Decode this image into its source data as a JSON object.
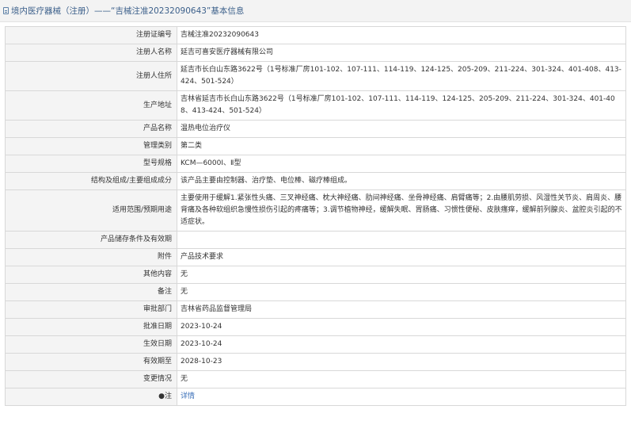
{
  "header": {
    "title": "境内医疗器械（注册）——“吉械注准20232090643”基本信息"
  },
  "rows": [
    {
      "label": "注册证编号",
      "value": "吉械注准20232090643"
    },
    {
      "label": "注册人名称",
      "value": "延吉可喜安医疗器械有限公司"
    },
    {
      "label": "注册人住所",
      "value": "延吉市长白山东路3622号（1号标准厂房101-102、107-111、114-119、124-125、205-209、211-224、301-324、401-408、413-424、501-524）"
    },
    {
      "label": "生产地址",
      "value": "吉林省延吉市长白山东路3622号（1号标准厂房101-102、107-111、114-119、124-125、205-209、211-224、301-324、401-408、413-424、501-524）"
    },
    {
      "label": "产品名称",
      "value": "温热电位治疗仪"
    },
    {
      "label": "管理类别",
      "value": "第二类"
    },
    {
      "label": "型号规格",
      "value": "KCM—6000Ⅰ、Ⅱ型"
    },
    {
      "label": "结构及组成/主要组成成分",
      "value": "该产品主要由控制器、治疗垫、电位棒、磁疗棒组成。"
    },
    {
      "label": "适用范围/预期用途",
      "value": "主要使用于缓解1.紧张性头痛、三叉神经痛、枕大神经痛、肋间神经痛、坐骨神经痛、肩臂痛等；2.由腰肌劳损、风湿性关节炎、肩周炎、腰背痛及各种软组织急慢性损伤引起的疼痛等；3.调节植物神经，缓解失眠、胃肠痛、习惯性便秘、皮肤瘙痒，缓解前列腺炎、盆腔炎引起的不适症状。"
    },
    {
      "label": "产品储存条件及有效期",
      "value": ""
    },
    {
      "label": "附件",
      "value": "产品技术要求"
    },
    {
      "label": "其他内容",
      "value": "无"
    },
    {
      "label": "备注",
      "value": "无"
    },
    {
      "label": "审批部门",
      "value": "吉林省药品监督管理局"
    },
    {
      "label": "批准日期",
      "value": "2023-10-24"
    },
    {
      "label": "生效日期",
      "value": "2023-10-24"
    },
    {
      "label": "有效期至",
      "value": "2028-10-23"
    },
    {
      "label": "变更情况",
      "value": "无"
    }
  ],
  "note_row": {
    "label": "●注",
    "link": "详情"
  }
}
